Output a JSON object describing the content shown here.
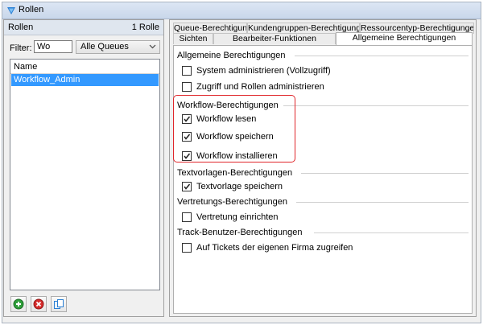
{
  "window": {
    "title": "Rollen"
  },
  "roles_panel": {
    "title": "Rollen",
    "count": "1 Rolle",
    "filter_label": "Filter:",
    "filter_value": "Wo",
    "queue_select": "Alle Queues",
    "list_header": "Name",
    "rows": [
      "Workflow_Admin"
    ],
    "toolbar": {
      "add": "add-icon",
      "delete": "delete-icon",
      "copy": "copy-icon"
    }
  },
  "tabs": [
    "Queue-Berechtigungen",
    "Kundengruppen-Berechtigungen",
    "Ressourcentyp-Berechtigungen",
    "Sichten",
    "Bearbeiter-Funktionen",
    "Allgemeine Berechtigungen"
  ],
  "groups": [
    {
      "label": "Allgemeine Berechtigungen",
      "items": [
        {
          "label": "System administrieren (Vollzugriff)",
          "checked": false
        },
        {
          "label": "Zugriff und Rollen administrieren",
          "checked": false
        }
      ]
    },
    {
      "label": "Workflow-Berechtigungen",
      "items": [
        {
          "label": "Workflow lesen",
          "checked": true
        },
        {
          "label": "Workflow speichern",
          "checked": true
        },
        {
          "label": "Workflow installieren",
          "checked": true
        }
      ]
    },
    {
      "label": "Textvorlagen-Berechtigungen",
      "items": [
        {
          "label": "Textvorlage speichern",
          "checked": true
        }
      ]
    },
    {
      "label": "Vertretungs-Berechtigungen",
      "items": [
        {
          "label": "Vertretung einrichten",
          "checked": false
        }
      ]
    },
    {
      "label": "Track-Benutzer-Berechtigungen",
      "items": [
        {
          "label": "Auf Tickets der eigenen Firma zugreifen",
          "checked": false
        }
      ]
    }
  ],
  "colors": {
    "highlight": "#e0262b",
    "selection": "#3399ff"
  }
}
